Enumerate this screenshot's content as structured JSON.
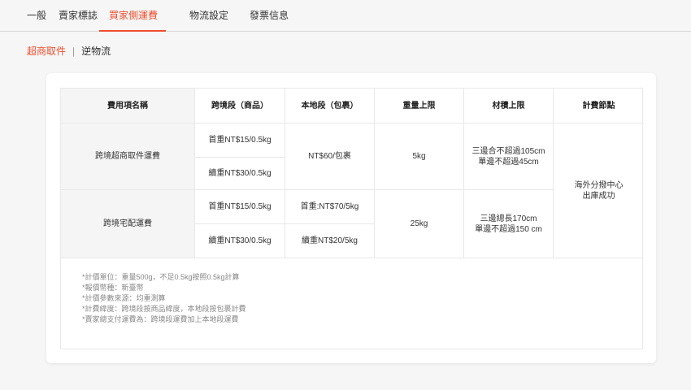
{
  "tabs": [
    {
      "label": "一般"
    },
    {
      "label": "賣家標誌"
    },
    {
      "label": "買家側運費"
    },
    {
      "label": "物流設定"
    },
    {
      "label": "發票信息"
    }
  ],
  "subnav": {
    "active": "超商取件",
    "separator": "|",
    "other": "逆物流"
  },
  "table": {
    "headers": {
      "name": "費用項名稱",
      "cross": "跨境段（商品）",
      "local": "本地段（包裹）",
      "weight": "重量上限",
      "volume": "材積上限",
      "billing": "計費節點"
    },
    "row1": {
      "name": "跨境超商取件運費",
      "cross_first": "首重NT$15/0.5kg",
      "cross_cont": "續重NT$30/0.5kg",
      "local": "NT$60/包裹",
      "weight": "5kg",
      "volume_1": "三邊合不超過105cm",
      "volume_2": "單邊不超過45cm"
    },
    "row2": {
      "name": "跨境宅配運費",
      "cross_first": "首重NT$15/0.5kg",
      "cross_cont": "續重NT$30/0.5kg",
      "local_first": "首重:NT$70/5kg",
      "local_cont": "續重NT$20/5kg",
      "weight": "25kg",
      "volume_1": "三邊總長170cm",
      "volume_2": "單邊不超過150 cm"
    },
    "billing_1": "海外分撥中心",
    "billing_2": "出庫成功"
  },
  "notes": [
    "*計價單位：重量500g，不足0.5kg按照0.5kg計算",
    "*報價幣種：新臺幣",
    "*計價參數來源：均重測算",
    "*計費緯度：跨境段按商品緯度，本地段按包裹計費",
    "*賣家總支付運費為：跨境段運費加上本地段運費"
  ],
  "colors": {
    "accent": "#ee4d2d"
  }
}
